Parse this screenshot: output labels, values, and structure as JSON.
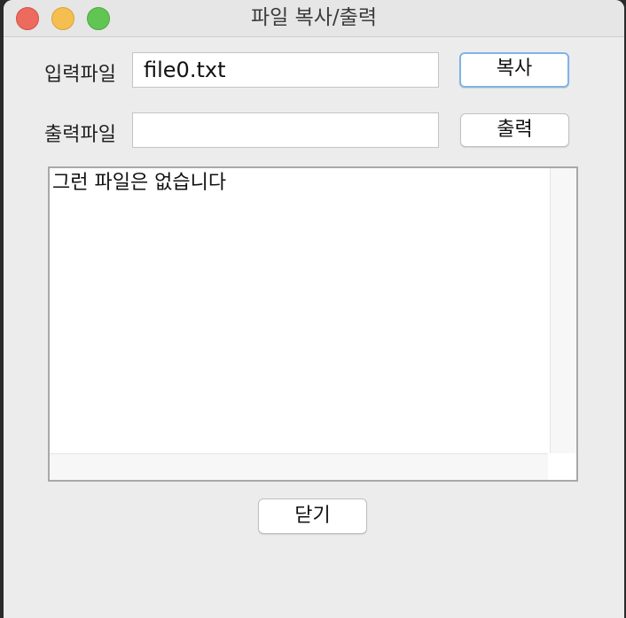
{
  "window": {
    "title": "파일 복사/출력"
  },
  "form": {
    "input_label": "입력파일",
    "input_value": "file0.txt",
    "output_label": "출력파일",
    "output_value": "",
    "copy_button": "복사",
    "print_button": "출력"
  },
  "output_area": {
    "text": "그런 파일은 없습니다"
  },
  "footer": {
    "close_button": "닫기"
  }
}
